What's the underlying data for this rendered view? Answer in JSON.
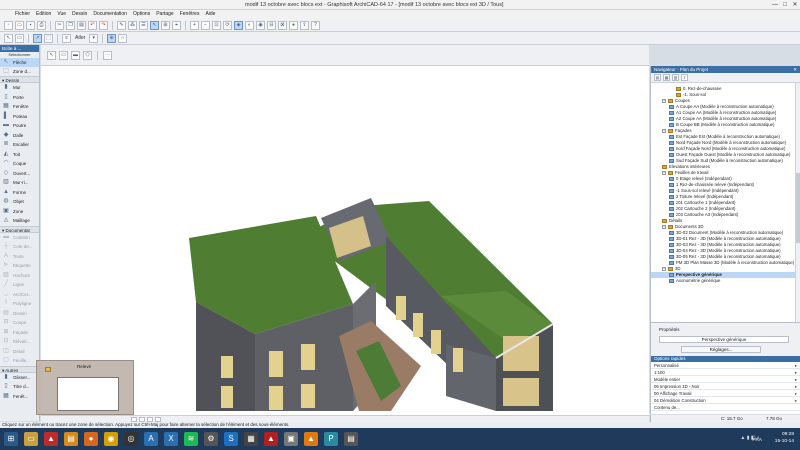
{
  "window": {
    "title": "modif 13 octobre avec blocs ext - Graphisoft ArchiCAD-64 17 - [modif 13 octobre avec blocs ext 3D / Tous]",
    "controls": [
      "—",
      "□",
      "✕"
    ]
  },
  "menu": [
    "Fichier",
    "Edition",
    "Vue",
    "Dessin",
    "Documentation",
    "Options",
    "Partage",
    "Fenêtres",
    "Aide"
  ],
  "toolbar": {
    "layer_label": "Atler"
  },
  "toolbox": {
    "title": "Boîte à ...",
    "select_label": "Sélectionner",
    "arrow_label": "Flèche",
    "marquee_label": "Zone d...",
    "sections": {
      "dessin": "Dessin",
      "document": "Documentat",
      "autres": "Autres"
    },
    "dessin_items": [
      "Mur",
      "Porte",
      "Fenêtre",
      "Poteau",
      "Poutre",
      "Dalle",
      "Escalier",
      "Toit",
      "Coque",
      "Ouvert...",
      "Mur-ri...",
      "Forme",
      "Objet",
      "Zone",
      "Maillage"
    ],
    "document_items": [
      "Cotation",
      "Cote de...",
      "Texte",
      "Etiquette",
      "Hachure",
      "Ligne",
      "Arc/Cer...",
      "Polyligne",
      "Dessin",
      "Coupe",
      "Façade",
      "Elévati...",
      "Détail",
      "Feuille..."
    ],
    "autres_items": [
      "Glisser...",
      "Titre d...",
      "Fenêt..."
    ]
  },
  "thumbnail": {
    "title": "Relevé"
  },
  "navigator": {
    "title": "Navigateur - Plan du Projet",
    "close": "✕",
    "tree": [
      {
        "level": 3,
        "label": "0. Rez-de-chaussée",
        "icon": "folder"
      },
      {
        "level": 3,
        "label": "-1. Sous-sol",
        "icon": "folder"
      },
      {
        "level": 1,
        "label": "Coupes",
        "icon": "folder",
        "exp": "−"
      },
      {
        "level": 2,
        "label": "A Coupe AA (Modèle à reconstruction automatique)",
        "icon": "view"
      },
      {
        "level": 2,
        "label": "A1 Coupe AA (Modèle à reconstruction automatique)",
        "icon": "view"
      },
      {
        "level": 2,
        "label": "A2 Coupe AA (Modèle à reconstruction automatique)",
        "icon": "view"
      },
      {
        "level": 2,
        "label": "B Coupe BB (Modèle à reconstruction automatique)",
        "icon": "view"
      },
      {
        "level": 1,
        "label": "Façades",
        "icon": "folder",
        "exp": "−"
      },
      {
        "level": 2,
        "label": "Est Façade Est (Modèle à reconstruction automatique)",
        "icon": "view"
      },
      {
        "level": 2,
        "label": "Nord Façade Nord (Modèle à reconstruction automatique)",
        "icon": "view"
      },
      {
        "level": 2,
        "label": "nord Façade Nord (Modèle à reconstruction automatique)",
        "icon": "view"
      },
      {
        "level": 2,
        "label": "Ouest Façade Ouest (Modèle à reconstruction automatique)",
        "icon": "view"
      },
      {
        "level": 2,
        "label": "Sud Façade Sud (Modèle à reconstruction automatique)",
        "icon": "view"
      },
      {
        "level": 1,
        "label": "Elevations intérieures",
        "icon": "folder"
      },
      {
        "level": 1,
        "label": "Feuilles de travail",
        "icon": "folder",
        "exp": "−"
      },
      {
        "level": 2,
        "label": "0 Etage relevé (Indépendant)",
        "icon": "view"
      },
      {
        "level": 2,
        "label": "1 Rez-de-chaussée relevé (Indépendant)",
        "icon": "view"
      },
      {
        "level": 2,
        "label": "-1 Sous-sol relevé (Indépendant)",
        "icon": "view"
      },
      {
        "level": 2,
        "label": "2 Toiture relevé (Indépendant)",
        "icon": "view"
      },
      {
        "level": 2,
        "label": "z01 Cartouche 1 (Indépendant)",
        "icon": "view"
      },
      {
        "level": 2,
        "label": "z02 Cartouche 2 (Indépendant)",
        "icon": "view"
      },
      {
        "level": 2,
        "label": "z03 Cartouche A3 (Indépendant)",
        "icon": "view"
      },
      {
        "level": 1,
        "label": "Détails",
        "icon": "folder"
      },
      {
        "level": 1,
        "label": "Documents 3D",
        "icon": "folder",
        "exp": "−"
      },
      {
        "level": 2,
        "label": "3D-02 Document (Modèle à reconstruction automatique)",
        "icon": "view"
      },
      {
        "level": 2,
        "label": "3D-01 Rez - 3D (Modèle à reconstruction automatique)",
        "icon": "view"
      },
      {
        "level": 2,
        "label": "3D-03 Rez - 3D (Modèle à reconstruction automatique)",
        "icon": "view"
      },
      {
        "level": 2,
        "label": "3D-04 Rez - 3D (Modèle à reconstruction automatique)",
        "icon": "view"
      },
      {
        "level": 2,
        "label": "3D-05 Rez - 3D (Modèle à reconstruction automatique)",
        "icon": "view"
      },
      {
        "level": 2,
        "label": "PM 3D Plan Masse 3D (Modèle à reconstruction automatique)",
        "icon": "view"
      },
      {
        "level": 1,
        "label": "3D",
        "icon": "folder",
        "exp": "−"
      },
      {
        "level": 2,
        "label": "Perspective générique",
        "icon": "view",
        "highlight": true
      },
      {
        "level": 2,
        "label": "Axonométrie générique",
        "icon": "view"
      }
    ]
  },
  "properties": {
    "label": "Propriétés",
    "view_name": "Perspective générique",
    "settings_button": "Réglages..."
  },
  "quick_options": {
    "title": "Options rapides",
    "rows": [
      "Personnalisé",
      "1:100",
      "Modèle entier",
      "06 Impression 3D - Noir",
      "00 Affichage Travail",
      "04 Démolition Construction",
      "Contenu de..."
    ]
  },
  "info": {
    "disk": "C: 15.7 Go",
    "mem": "7.78 Go"
  },
  "status_text": "Cliquez sur un élément ou tracez une zone de sélection. Appuyez sur Ctrl+Maj pour faire alterner la sélection de l'élément et des sous-éléments.",
  "taskbar": {
    "lang": "FRA",
    "time": "09:28",
    "date": "15-10-14"
  }
}
